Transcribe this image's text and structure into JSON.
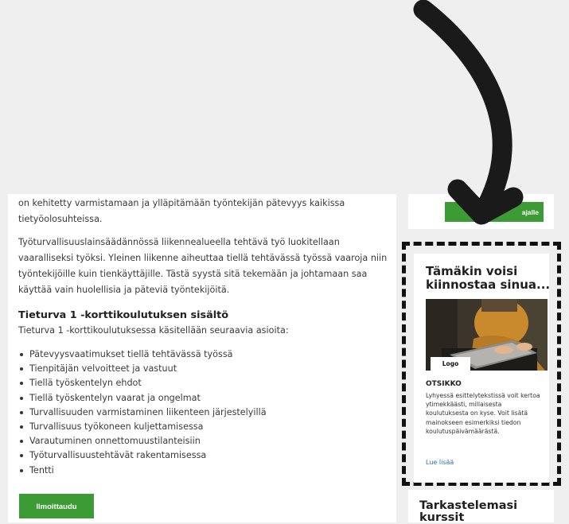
{
  "main": {
    "para1": "on kehitetty varmistamaan ja ylläpitämään työntekijän pätevyys kaikissa tietyöolosuhteissa.",
    "para2": "Työturvallisuuslainsäädännössä liikennealueella tehtävä työ luokitellaan vaaralliseksi työksi. Yleinen liikenne aiheuttaa tiellä tehtävässä työssä vaaroja niin työntekijöille kuin tienkäyttäjille. Tästä syystä sitä tekemään ja johtamaan saa käyttää vain huolellisia ja päteviä työntekijöitä.",
    "section_title": "Tieturva 1 -korttikoulutuksen sisältö",
    "section_intro": "Tieturva 1 -korttikoulutuksessa käsitellään seuraavia asioita:",
    "topics": [
      "Pätevyysvaatimukset tiellä tehtävässä työssä",
      "Tienpitäjän velvoitteet ja vastuut",
      "Tiellä työskentelyn ehdot",
      "Tiellä työskentelyn vaarat ja ongelmat",
      "Turvallisuuden varmistaminen liikenteen järjestelyillä",
      "Turvallisuus työkoneen kuljettamisessa",
      "Varautuminen onnettomuustilanteisiin",
      "Työturvallisuustehtävät rakentamisessa",
      "Tentti"
    ],
    "register_label": "Ilmoittaudu"
  },
  "sidebar": {
    "top_button_label": "ajalle",
    "promo": {
      "title": "Tämäkin voisi kiinnostaa sinua...",
      "logo_label": "Logo",
      "heading": "OTSIKKO",
      "text": "Lyhyessä esittelytekstissä voit kertoa ytimekkäästi, millaisesta koulutuksesta on kyse. Voit lisätä mainokseen esimerkiksi tiedon koulutuspäivämäärästä.",
      "link_label": "Lue lisää"
    },
    "recent_title": "Tarkastelemasi kurssit"
  },
  "colors": {
    "background": "#efefef",
    "button_green": "#3d9b35",
    "link_blue": "#2b6cb0",
    "dashed_border": "#111111"
  }
}
